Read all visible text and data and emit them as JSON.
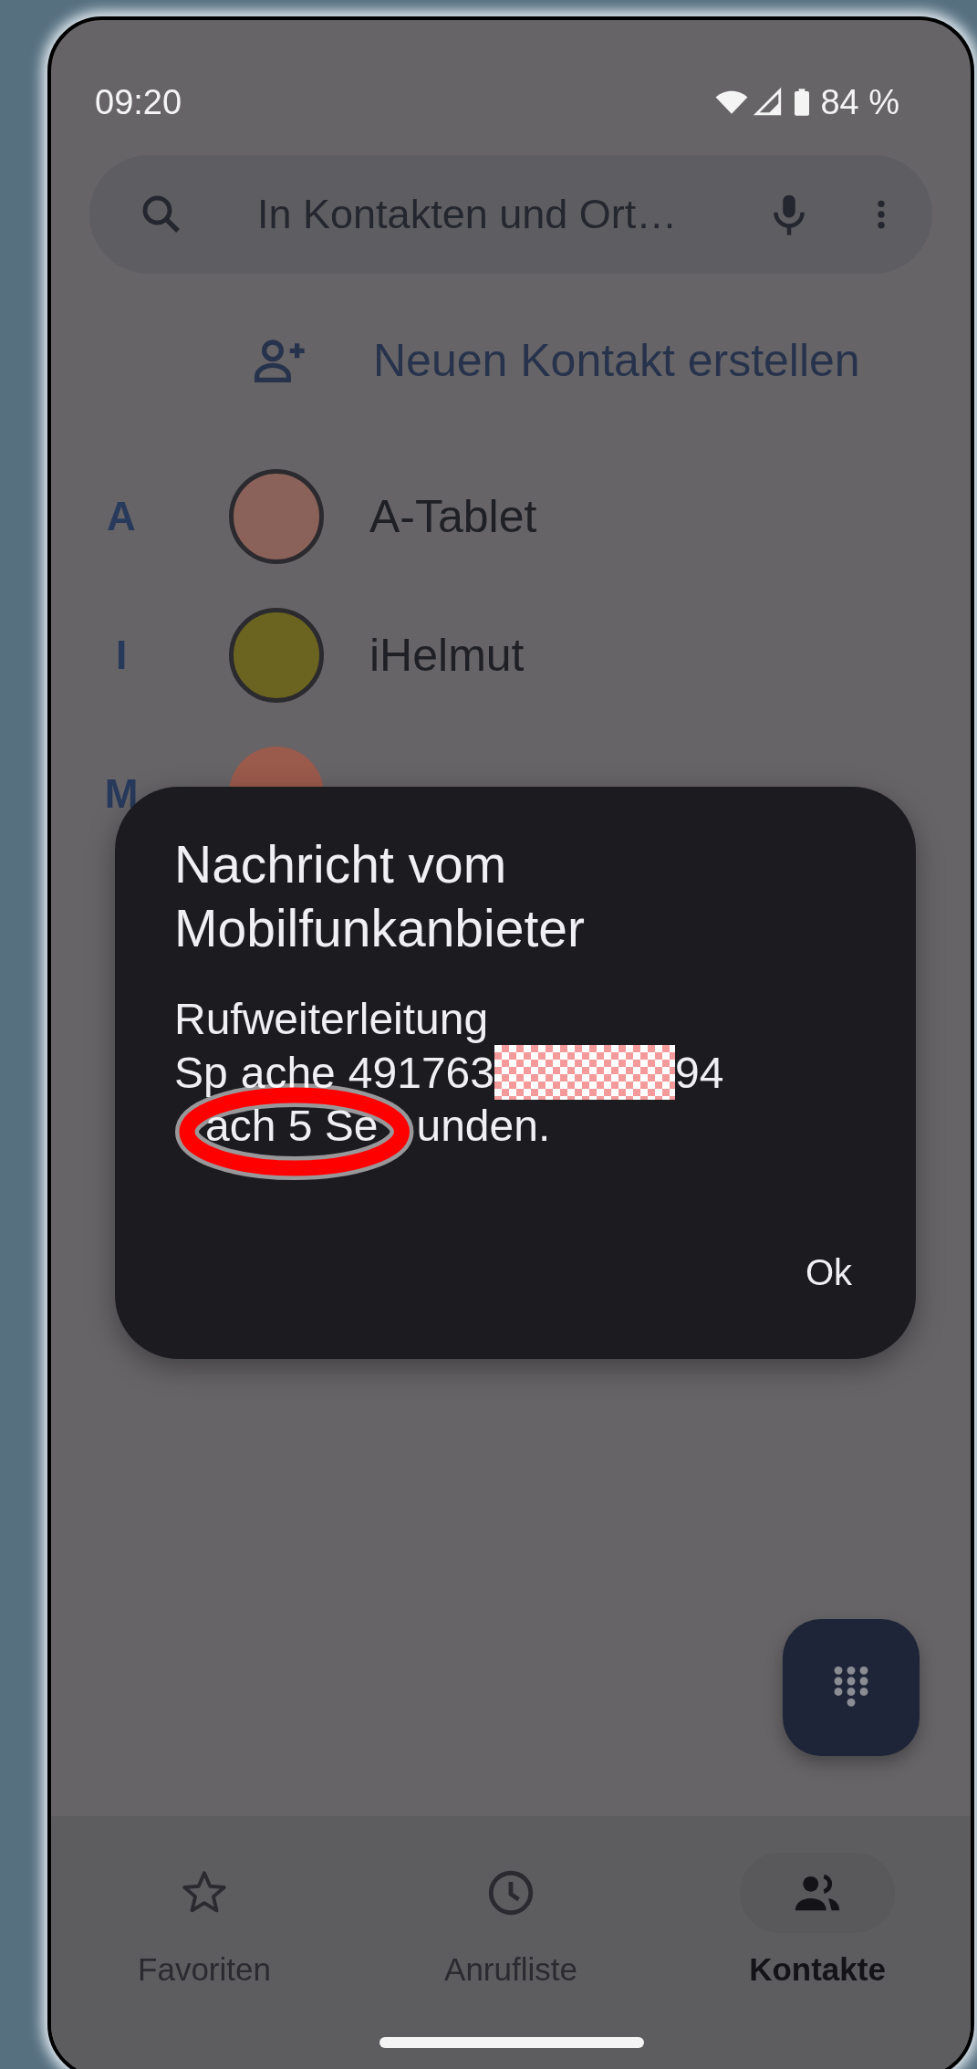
{
  "status_bar": {
    "time": "09:20",
    "battery": "84 %"
  },
  "search": {
    "placeholder": "In Kontakten und Ort…"
  },
  "create_contact": {
    "label": "Neuen Kontakt erstellen"
  },
  "contacts": [
    {
      "index_letter": "A",
      "name": "A-Tablet",
      "kind": "photo",
      "color": "#8a6259"
    },
    {
      "index_letter": "I",
      "name": "iHelmut",
      "kind": "photo",
      "color": "#6b6420"
    },
    {
      "index_letter": "M",
      "kind": "plain",
      "color": "#9a5a4c"
    }
  ],
  "dialog": {
    "title": "Nachricht vom Mobilfunkanbieter",
    "body_lines": [
      [
        {
          "kind": "text",
          "text": "Rufweiterleitung"
        }
      ],
      [
        {
          "kind": "text",
          "text": "Sp"
        },
        {
          "kind": "covered"
        },
        {
          "kind": "text",
          "text": "ache"
        },
        {
          "kind": "covered"
        },
        {
          "kind": "text",
          "text": "491763"
        },
        {
          "kind": "redaction"
        },
        {
          "kind": "text",
          "text": "94"
        }
      ],
      [
        {
          "kind": "covered"
        },
        {
          "kind": "text",
          "text": "ach 5 Se"
        },
        {
          "kind": "covered"
        },
        {
          "kind": "text",
          "text": "unden."
        }
      ]
    ],
    "button": "Ok"
  },
  "nav": [
    {
      "label": "Favoriten",
      "selected": false
    },
    {
      "label": "Anrufliste",
      "selected": false
    },
    {
      "label": "Kontakte",
      "selected": true
    }
  ]
}
